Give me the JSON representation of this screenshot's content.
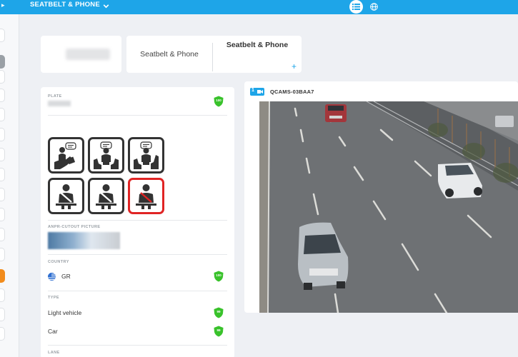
{
  "header": {
    "title": "SEATBELT & PHONE",
    "views": [
      {
        "name": "list-view",
        "icon": "list-icon",
        "active": true
      },
      {
        "name": "map-view",
        "icon": "globe-icon",
        "active": false
      }
    ]
  },
  "colors": {
    "accent": "#1ea5e8",
    "alert": "#e02424",
    "score_green": "#39c22b",
    "highlight": "#f28c1c"
  },
  "tabs": {
    "inactive_label": "Seatbelt & Phone",
    "active_label": "Seatbelt & Phone",
    "add_label": "+"
  },
  "detail": {
    "plate": {
      "label": "PLATE",
      "score": "100"
    },
    "violations": [
      {
        "icon": "phone-use-icon",
        "status": "ok"
      },
      {
        "icon": "phone-use-icon",
        "status": "ok"
      },
      {
        "icon": "phone-use-icon",
        "status": "ok"
      },
      {
        "icon": "seatbelt-icon",
        "status": "ok"
      },
      {
        "icon": "seatbelt-icon",
        "status": "ok"
      },
      {
        "icon": "seatbelt-icon",
        "status": "violation"
      }
    ],
    "anpr": {
      "label": "ANPR-CUTOUT PICTURE"
    },
    "country": {
      "label": "COUNTRY",
      "value": "GR",
      "score": "100"
    },
    "type": {
      "label": "TYPE",
      "values": [
        "Light vehicle",
        "Car"
      ],
      "scores": [
        "99",
        "99"
      ]
    },
    "lane": {
      "label": "LANE"
    }
  },
  "camera": {
    "badge": "1",
    "name": "QCAMS-03BAA7"
  }
}
